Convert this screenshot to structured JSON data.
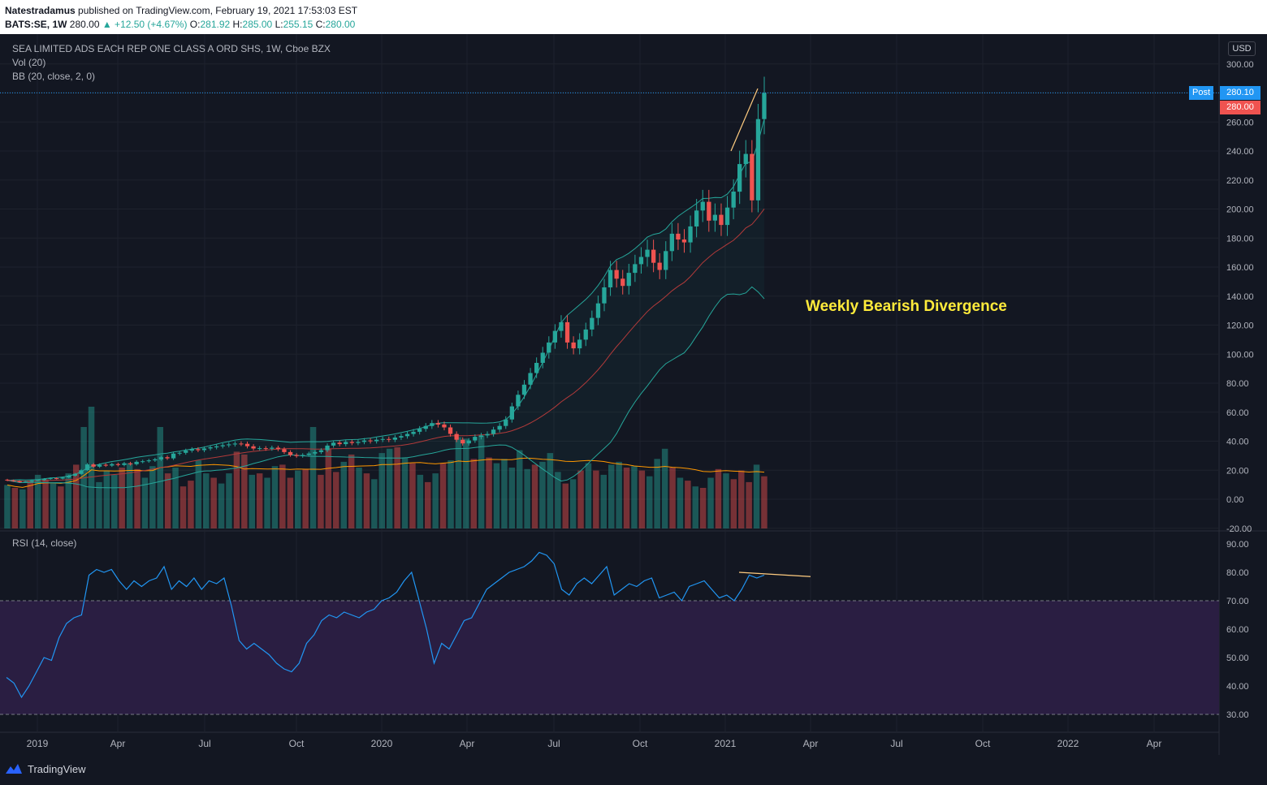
{
  "header": {
    "author": "Natestradamus",
    "published": "published on TradingView.com, February 19, 2021 17:53:03 EST",
    "symbol": "BATS:SE, 1W",
    "last": "280.00",
    "change": "▲ +12.50 (+4.67%)",
    "o_label": "O:",
    "o": "281.92",
    "h_label": "H:",
    "h": "285.00",
    "l_label": "L:",
    "l": "255.15",
    "c_label": "C:",
    "c": "280.00"
  },
  "legend": {
    "title": "SEA LIMITED ADS EACH REP ONE CLASS A ORD SHS, 1W, Cboe BZX",
    "vol": "Vol (20)",
    "bb": "BB (20, close, 2, 0)",
    "rsi": "RSI (14, close)"
  },
  "currency": "USD",
  "post_label": "Post",
  "post_price": "280.10",
  "last_price": "280.00",
  "annotation": "Weekly Bearish Divergence",
  "footer": {
    "brand": "TradingView"
  },
  "colors": {
    "up": "#26a69a",
    "down": "#ef5350",
    "bb_band": "#26a69a",
    "bb_basis": "#b23a3a",
    "rsi": "#2196f3",
    "vol_ma": "#ff9800",
    "trendline": "#ffcc80",
    "annotation": "#ffeb3b",
    "rsi_zone": "#2a1e42"
  },
  "chart_data": {
    "type": "candlestick",
    "price_axis_ticks": [
      "300.00",
      "280.00",
      "260.00",
      "240.00",
      "220.00",
      "200.00",
      "180.00",
      "160.00",
      "140.00",
      "120.00",
      "100.00",
      "80.00",
      "60.00",
      "40.00",
      "20.00",
      "0.00",
      "-20.00"
    ],
    "rsi_axis_ticks": [
      "90.00",
      "80.00",
      "70.00",
      "60.00",
      "50.00",
      "40.00",
      "30.00"
    ],
    "time_axis_labels": [
      "2019",
      "Apr",
      "Jul",
      "Oct",
      "2020",
      "Apr",
      "Jul",
      "Oct",
      "2021",
      "Apr",
      "Jul",
      "Oct",
      "2022",
      "Apr"
    ],
    "price_ylim": [
      -20,
      300
    ],
    "rsi_ylim": [
      30,
      90
    ],
    "rsi_levels": [
      70,
      30
    ],
    "closes": [
      13,
      12.5,
      11.8,
      12.2,
      13,
      13.2,
      14,
      14.5,
      14.2,
      15,
      16.2,
      17.5,
      20,
      24,
      22.5,
      23.8,
      23.2,
      24.2,
      23.6,
      24.8,
      24.2,
      25.8,
      26.2,
      26.8,
      27.5,
      29,
      28.2,
      31.5,
      32,
      33.5,
      34.5,
      33.8,
      35,
      35.8,
      36.5,
      37.2,
      37.8,
      38.4,
      38.2,
      36.5,
      35,
      35.2,
      34.8,
      35.5,
      34.5,
      32.5,
      30.5,
      29.8,
      30.5,
      31.5,
      32.5,
      33.8,
      37,
      39,
      38,
      39.5,
      38.8,
      39.5,
      40.5,
      40,
      41,
      41.5,
      41,
      42.5,
      43.5,
      45,
      46.5,
      48.5,
      50.5,
      52.5,
      51.5,
      49.5,
      45,
      41,
      38.5,
      40.5,
      43,
      44,
      45,
      48,
      50.5,
      55,
      64,
      72,
      79,
      87,
      94,
      101,
      108,
      116,
      122,
      108,
      104,
      110,
      117,
      125,
      135,
      146,
      158,
      152,
      147,
      156,
      162,
      167,
      172,
      163,
      158,
      171,
      183,
      179,
      177,
      188,
      199,
      205,
      192,
      196,
      189,
      201,
      212,
      231,
      238,
      206,
      262,
      280
    ],
    "rsi": [
      43,
      41,
      36,
      40,
      45,
      50,
      49,
      57,
      62,
      64,
      65,
      79,
      81,
      80,
      81,
      77,
      74,
      77,
      75,
      77,
      78,
      82,
      74,
      77,
      75,
      78,
      74,
      77,
      76,
      78,
      68,
      56,
      53,
      55,
      53,
      51,
      48,
      46,
      45,
      48,
      55,
      58,
      63,
      65,
      64,
      66,
      65,
      64,
      66,
      67,
      70,
      71,
      73,
      77,
      80,
      70,
      60,
      48,
      55,
      53,
      58,
      63,
      64,
      69,
      74,
      76,
      78,
      80,
      81,
      82,
      84,
      87,
      86,
      83,
      74,
      72,
      76,
      78,
      76,
      79,
      82,
      72,
      74,
      76,
      75,
      77,
      78,
      71,
      72,
      73,
      70,
      75,
      76,
      77,
      74,
      71,
      72,
      70,
      74,
      79,
      78,
      79
    ],
    "volume": [
      30,
      28,
      27,
      33,
      37,
      34,
      31,
      29,
      38,
      44,
      70,
      84,
      32,
      40,
      37,
      42,
      45,
      41,
      35,
      43,
      70,
      38,
      42,
      29,
      33,
      47,
      38,
      35,
      31,
      38,
      53,
      51,
      37,
      38,
      35,
      43,
      44,
      35,
      40,
      41,
      70,
      37,
      55,
      39,
      46,
      51,
      42,
      38,
      34,
      52,
      55,
      56,
      49,
      45,
      37,
      32,
      38,
      45,
      47,
      63,
      62,
      48,
      64,
      49,
      45,
      48,
      42,
      54,
      41,
      44,
      46,
      52,
      39,
      31,
      34,
      40,
      45,
      40,
      37,
      44,
      46,
      42,
      43,
      40,
      36,
      48,
      55,
      42,
      35,
      33,
      29,
      28,
      35,
      41,
      38,
      34,
      40,
      32,
      44,
      36
    ],
    "series": [
      {
        "name": "Vol (20)",
        "kind": "volume"
      },
      {
        "name": "BB (20, close, 2, 0)",
        "kind": "bollinger"
      },
      {
        "name": "RSI (14, close)",
        "kind": "rsi"
      }
    ]
  }
}
